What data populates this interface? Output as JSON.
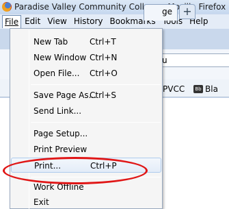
{
  "window": {
    "title": "Paradise Valley Community College - Mozilla Firefox"
  },
  "menubar": {
    "items": [
      "File",
      "Edit",
      "View",
      "History",
      "Bookmarks",
      "Tools",
      "Help"
    ],
    "open": "File"
  },
  "background": {
    "tab_label": "ge",
    "new_tab_symbol": "+",
    "url_fragment": "u",
    "bookmark_1": "PVCC",
    "bookmark_2_icon_text": "Bb",
    "bookmark_2": "Bla"
  },
  "file_menu": {
    "items": [
      {
        "label": "New Tab",
        "shortcut": "Ctrl+T"
      },
      {
        "label": "New Window",
        "shortcut": "Ctrl+N"
      },
      {
        "label": "Open File...",
        "shortcut": "Ctrl+O"
      },
      {
        "label": "Save Page As...",
        "shortcut": "Ctrl+S"
      },
      {
        "label": "Send Link...",
        "shortcut": ""
      },
      {
        "label": "Page Setup...",
        "shortcut": ""
      },
      {
        "label": "Print Preview",
        "shortcut": ""
      },
      {
        "label": "Print...",
        "shortcut": "Ctrl+P"
      },
      {
        "label": "Work Offline",
        "shortcut": ""
      },
      {
        "label": "Exit",
        "shortcut": ""
      }
    ],
    "highlighted": "Print..."
  },
  "colors": {
    "highlight_ellipse": "#e01616"
  }
}
